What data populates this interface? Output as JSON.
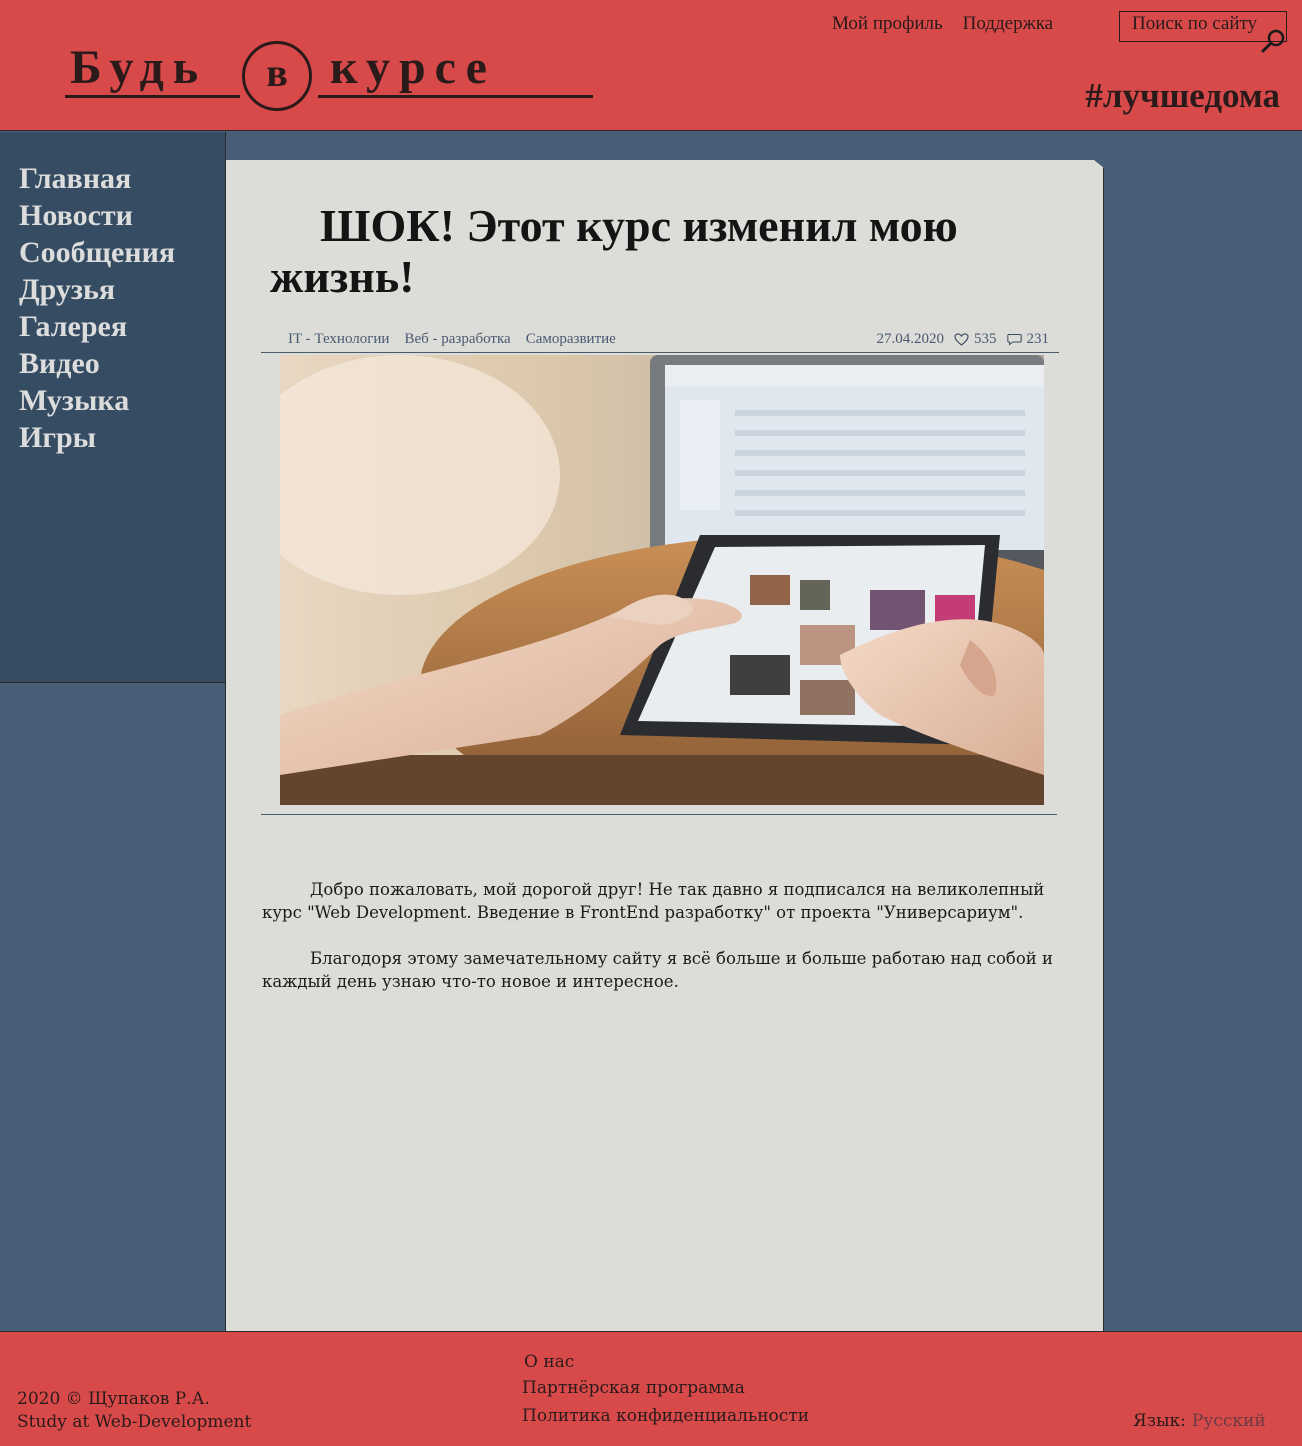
{
  "header": {
    "logo": {
      "word1": "Будь",
      "circle": "в",
      "word2": "курсе"
    },
    "links": [
      "Мой профиль",
      "Поддержка"
    ],
    "search_label": "Поиск по сайту",
    "search_icon": "magnifier-icon",
    "hashtag": "#лучшедома"
  },
  "sidebar": {
    "items": [
      "Главная",
      "Новости",
      "Сообщения",
      "Друзья",
      "Галерея",
      "Видео",
      "Музыка",
      "Игры"
    ]
  },
  "article": {
    "title": "ШОК! Этот курс изменил мою жизнь!",
    "tags": [
      "IT - Технологии",
      "Веб - разработка",
      "Саморазвитие"
    ],
    "date": "27.04.2020",
    "likes": "535",
    "like_icon": "heart-icon",
    "comments": "231",
    "comment_icon": "speech-bubble-icon",
    "paragraphs": [
      "Добро пожаловать, мой дорогой друг! Не так давно я подписался на великолепный курс \"Web Development. Введение в FrontEnd разработку\" от проекта \"Универсариум\".",
      "Благодоря этому замечательному сайту я всё больше и больше работаю над собой и каждый день узнаю что-то новое  и интересное."
    ]
  },
  "footer": {
    "copyright": "2020 © Щупаков Р.А.",
    "subtitle": "Study at Web-Development",
    "links": [
      "О нас",
      "Партнёрская программа",
      "Политика конфиденциальности"
    ],
    "language_label": "Язык:",
    "language_value": "Русский"
  },
  "colors": {
    "header_bg": "#d84a4a",
    "page_bg": "#485e77",
    "sidebar_bg": "#364c63",
    "article_bg": "#dcdcd8"
  }
}
